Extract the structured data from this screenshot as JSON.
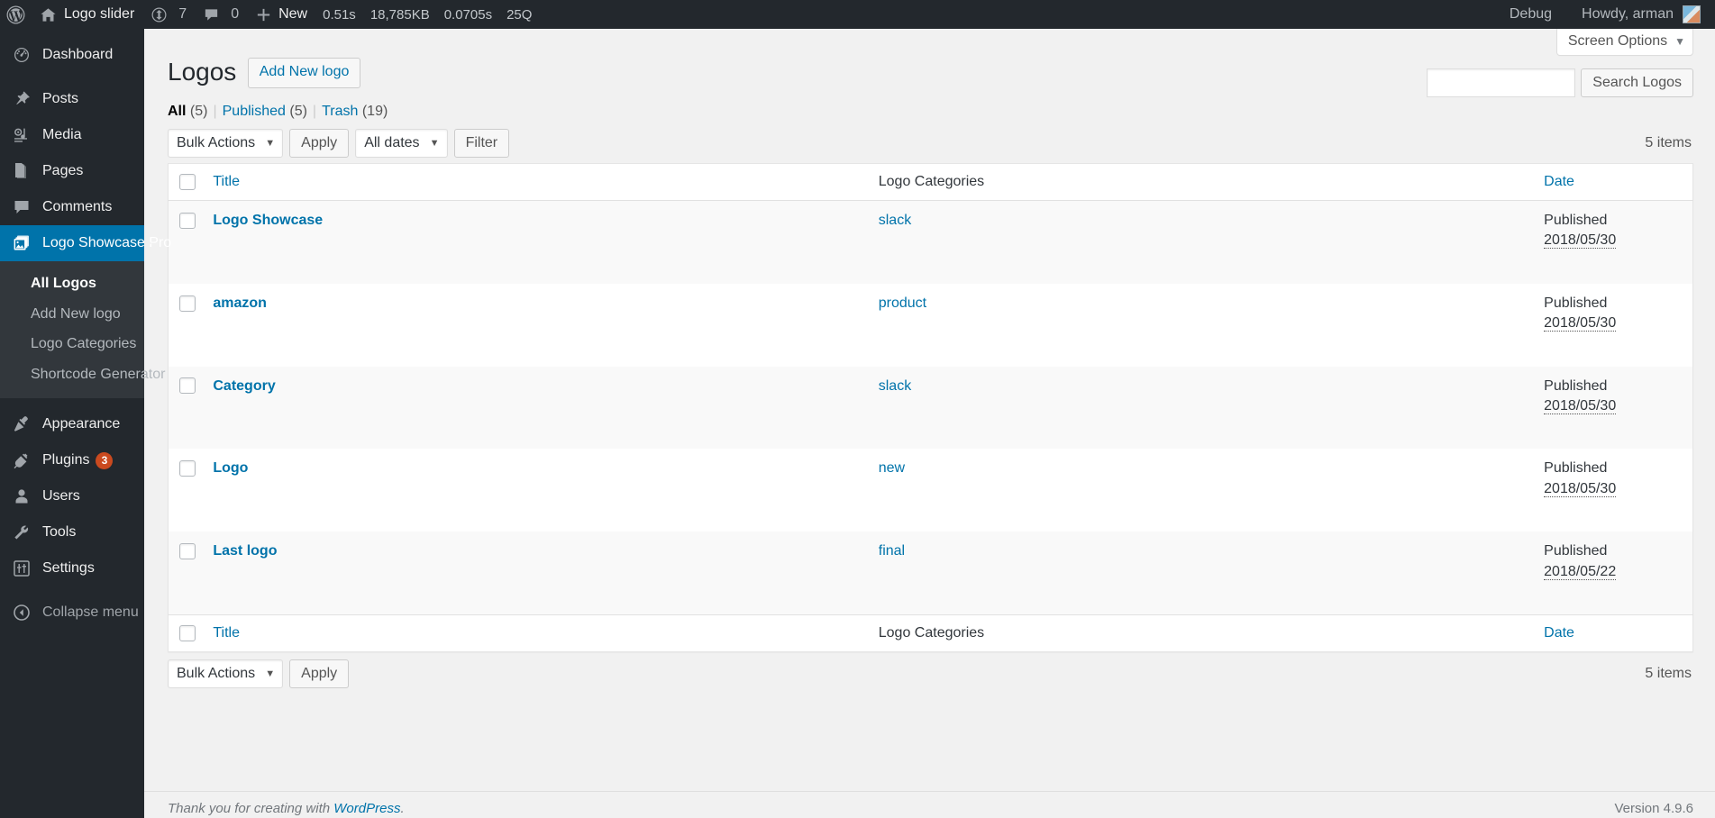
{
  "adminbar": {
    "wp_logo_name": "wordpress-logo-icon",
    "site_name": "Logo slider",
    "site_icon": "home-icon",
    "updates_icon": "updates-icon",
    "updates_count": "7",
    "comments_icon": "comment-bubble-icon",
    "comments_count": "0",
    "new_icon": "plus-icon",
    "new_label": "New",
    "metrics": [
      "0.51s",
      "18,785KB",
      "0.0705s",
      "25Q"
    ],
    "debug_label": "Debug",
    "howdy": "Howdy, arman",
    "avatar_name": "avatar"
  },
  "sidebar": {
    "items": [
      {
        "label": "Dashboard",
        "icon": "dashboard-icon",
        "current": false
      },
      {
        "label": "Posts",
        "icon": "pin-icon",
        "current": false
      },
      {
        "label": "Media",
        "icon": "media-icon",
        "current": false
      },
      {
        "label": "Pages",
        "icon": "pages-icon",
        "current": false
      },
      {
        "label": "Comments",
        "icon": "comments-icon",
        "current": false
      },
      {
        "label": "Logo Showcase Pro",
        "icon": "logo-showcase-icon",
        "current": true
      },
      {
        "label": "Appearance",
        "icon": "appearance-brush-icon",
        "current": false
      },
      {
        "label": "Plugins",
        "icon": "plugins-plug-icon",
        "badge": "3",
        "current": false
      },
      {
        "label": "Users",
        "icon": "users-icon",
        "current": false
      },
      {
        "label": "Tools",
        "icon": "tools-wrench-icon",
        "current": false
      },
      {
        "label": "Settings",
        "icon": "settings-sliders-icon",
        "current": false
      }
    ],
    "submenu": [
      {
        "label": "All Logos",
        "current": true
      },
      {
        "label": "Add New logo",
        "current": false
      },
      {
        "label": "Logo Categories",
        "current": false
      },
      {
        "label": "Shortcode Generator",
        "current": false
      }
    ],
    "collapse": {
      "label": "Collapse menu",
      "icon": "collapse-arrow-icon"
    }
  },
  "screen_meta": {
    "screen_options_label": "Screen Options",
    "caret": "▼"
  },
  "page": {
    "title": "Logos",
    "add_new_label": "Add New logo"
  },
  "views": [
    {
      "label": "All",
      "count": "(5)",
      "current": true
    },
    {
      "label": "Published",
      "count": "(5)",
      "current": false
    },
    {
      "label": "Trash",
      "count": "(19)",
      "current": false
    }
  ],
  "search": {
    "value": "",
    "placeholder": "",
    "submit_label": "Search Logos"
  },
  "tablenav_top": {
    "bulk_actions_value": "Bulk Actions",
    "apply_label": "Apply",
    "dates_value": "All dates",
    "filter_label": "Filter",
    "items_count": "5 items",
    "caret": "▼"
  },
  "tablenav_bottom": {
    "bulk_actions_value": "Bulk Actions",
    "apply_label": "Apply",
    "items_count": "5 items",
    "caret": "▼"
  },
  "table": {
    "columns": {
      "title": "Title",
      "categories": "Logo Categories",
      "date": "Date"
    },
    "rows": [
      {
        "title": "Logo Showcase",
        "category": "slack",
        "status": "Published",
        "date": "2018/05/30"
      },
      {
        "title": "amazon",
        "category": "product",
        "status": "Published",
        "date": "2018/05/30"
      },
      {
        "title": "Category",
        "category": "slack",
        "status": "Published",
        "date": "2018/05/30"
      },
      {
        "title": "Logo",
        "category": "new",
        "status": "Published",
        "date": "2018/05/30"
      },
      {
        "title": "Last logo",
        "category": "final",
        "status": "Published",
        "date": "2018/05/22"
      }
    ]
  },
  "footer": {
    "thanks_prefix": "Thank you for creating with ",
    "wordpress_link": "WordPress",
    "thanks_suffix": ".",
    "version": "Version 4.9.6"
  },
  "colors": {
    "admin_bg": "#23282d",
    "submenu_bg": "#32373c",
    "current_blue": "#0073aa",
    "content_bg": "#f1f1f1",
    "link_blue": "#0073aa",
    "badge_orange": "#ca4a1f"
  }
}
